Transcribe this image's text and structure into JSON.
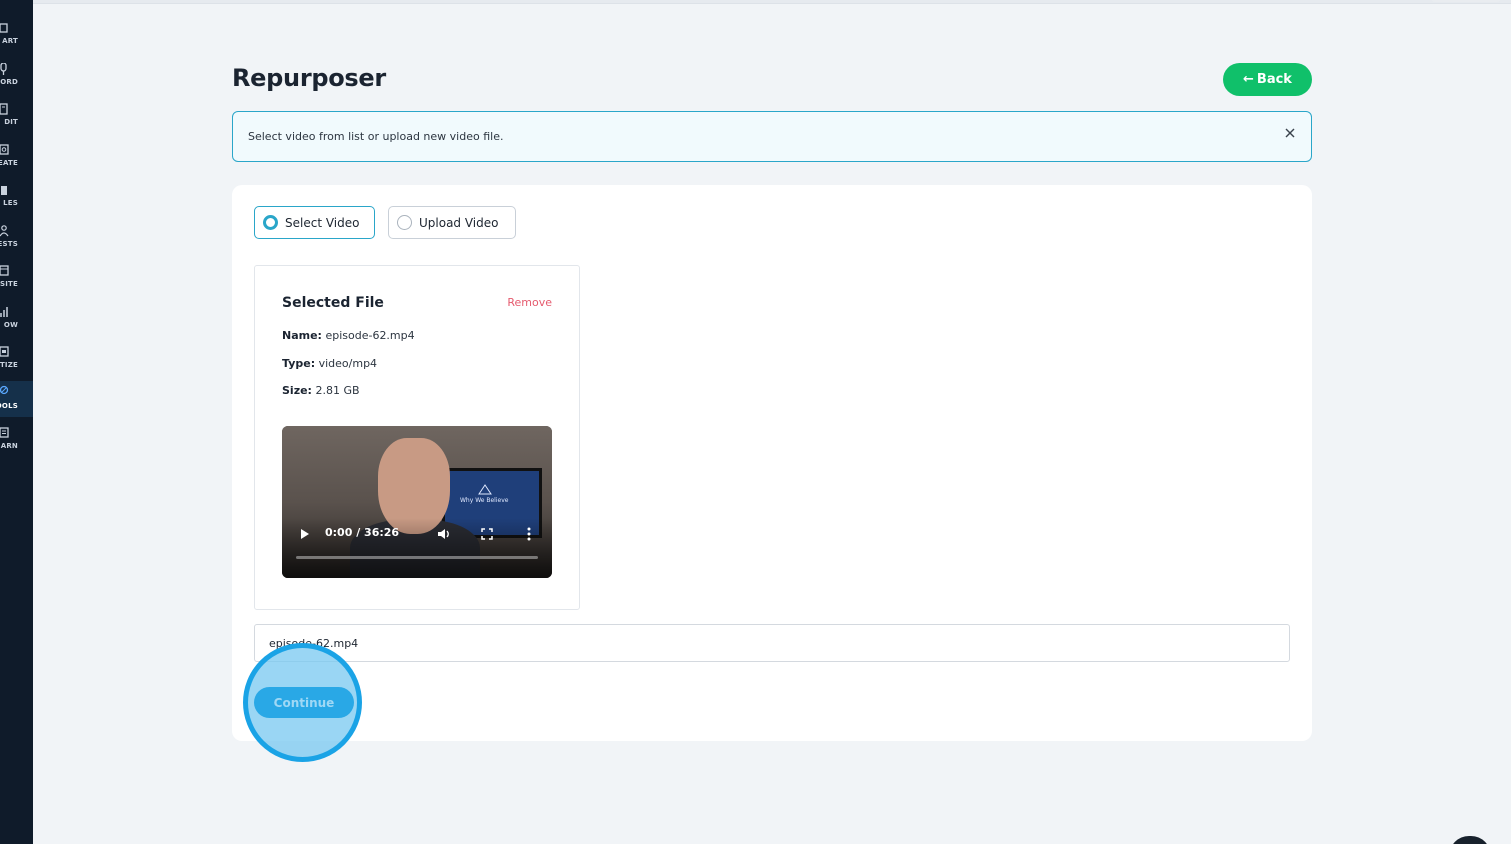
{
  "sidebar": {
    "items": [
      {
        "label": "ART",
        "icon": "rocket-icon"
      },
      {
        "label": "ORD",
        "icon": "microphone-icon"
      },
      {
        "label": "DIT",
        "icon": "edit-icon"
      },
      {
        "label": "EATE",
        "icon": "create-icon"
      },
      {
        "label": "LES",
        "icon": "files-icon"
      },
      {
        "label": "ESTS",
        "icon": "guests-icon"
      },
      {
        "label": "SITE",
        "icon": "website-icon"
      },
      {
        "label": "OW",
        "icon": "grow-chart-icon"
      },
      {
        "label": "ETIZE",
        "icon": "monetize-icon"
      },
      {
        "label": "OOLS",
        "icon": "tools-icon",
        "active": true
      },
      {
        "label": "ARN",
        "icon": "learn-icon"
      }
    ]
  },
  "header": {
    "title": "Repurposer",
    "back_label": "Back",
    "back_arrow": "←"
  },
  "alert": {
    "message": "Select video from list or upload new video file.",
    "close_glyph": "✕"
  },
  "source_options": {
    "select_label": "Select Video",
    "upload_label": "Upload Video",
    "selected": "Select Video"
  },
  "selected_file": {
    "title": "Selected File",
    "remove_label": "Remove",
    "name_label": "Name:",
    "name": "episode-62.mp4",
    "type_label": "Type:",
    "type": "video/mp4",
    "size_label": "Size:",
    "size": "2.81 GB"
  },
  "video_player": {
    "time": "0:00 / 36:26",
    "screen_text": "Why We Believe",
    "progress": 0
  },
  "filename_input": {
    "value": "episode-62.mp4"
  },
  "continue_label": "Continue",
  "colors": {
    "sidebar_bg": "#0f1b2a",
    "accent_green": "#10c06a",
    "accent_blue": "#2aa6c9",
    "remove_red": "#e55a6e",
    "continue_blue": "#29a8e6"
  }
}
